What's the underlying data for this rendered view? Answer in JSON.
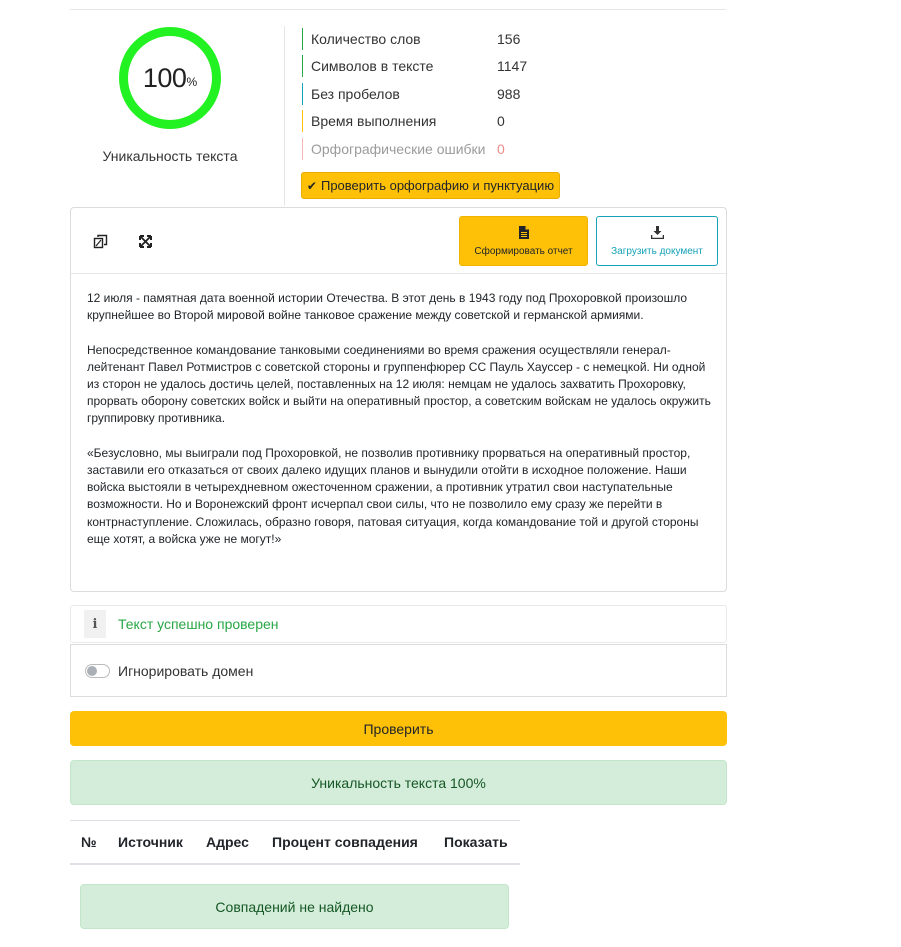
{
  "uniqueness": {
    "value": "100",
    "unit": "%",
    "percent": 100,
    "label": "Уникальность текста",
    "ring_color": "#22f222"
  },
  "stats": [
    {
      "label": "Количество слов",
      "value": "156",
      "color": "#28a745"
    },
    {
      "label": "Символов в тексте",
      "value": "1147",
      "color": "#28a745"
    },
    {
      "label": "Без пробелов",
      "value": "988",
      "color": "#17a2b8"
    },
    {
      "label": "Время выполнения",
      "value": "0",
      "color": "#ffc107"
    },
    {
      "label": "Орфографические ошибки",
      "value": "0",
      "color": "#f5b5b5"
    }
  ],
  "spell_button": {
    "icon": "check-icon",
    "label": "Проверить орфографию и пунктуацию"
  },
  "editor": {
    "toolbar": {
      "copy_icon": "copy-icon",
      "fullscreen_icon": "expand-icon",
      "report_button": {
        "icon": "file-icon",
        "label": "Сформировать отчет"
      },
      "upload_button": {
        "icon": "download-icon",
        "label": "Загрузить документ"
      }
    },
    "paragraphs": [
      "12 июля - памятная дата военной истории Отечества. В этот день в 1943 году под Прохоровкой произошло крупнейшее во Второй мировой войне танковое сражение между советской и германской армиями.",
      "Непосредственное командование танковыми соединениями во время сражения осуществляли генерал-лейтенант Павел Ротмистров с советской стороны и группенфюрер СС Пауль Хауссер - с немецкой. Ни одной из сторон не удалось достичь целей, поставленных на 12 июля: немцам не удалось захватить Прохоровку, прорвать оборону советских войск и выйти на оперативный простор, а советским войскам не удалось окружить группировку противника.",
      "«Безусловно, мы выиграли под Прохоровкой, не позволив противнику прорваться на оперативный простор, заставили его отказаться от своих далеко идущих планов и вынудили отойти в исходное положение. Наши войска выстояли в четырехдневном ожесточенном сражении, а противник утратил свои наступательные возможности. Но и Воронежский фронт исчерпал свои силы, что не позволило ему сразу же перейти в контрнаступление. Сложилась, образно говоря, патовая ситуация, когда командование той и другой стороны еще хотят, а войска уже не могут!»"
    ]
  },
  "info": {
    "icon": "info-icon",
    "text": "Текст успешно проверен"
  },
  "ignore_domain": {
    "label": "Игнорировать домен",
    "enabled": false
  },
  "check_button": {
    "label": "Проверить"
  },
  "result_alert": {
    "text": "Уникальность текста 100%"
  },
  "results_table": {
    "columns": [
      "№",
      "Источник",
      "Адрес",
      "Процент совпадения",
      "Показать"
    ]
  },
  "no_match": {
    "text": "Совпадений не найдено"
  }
}
